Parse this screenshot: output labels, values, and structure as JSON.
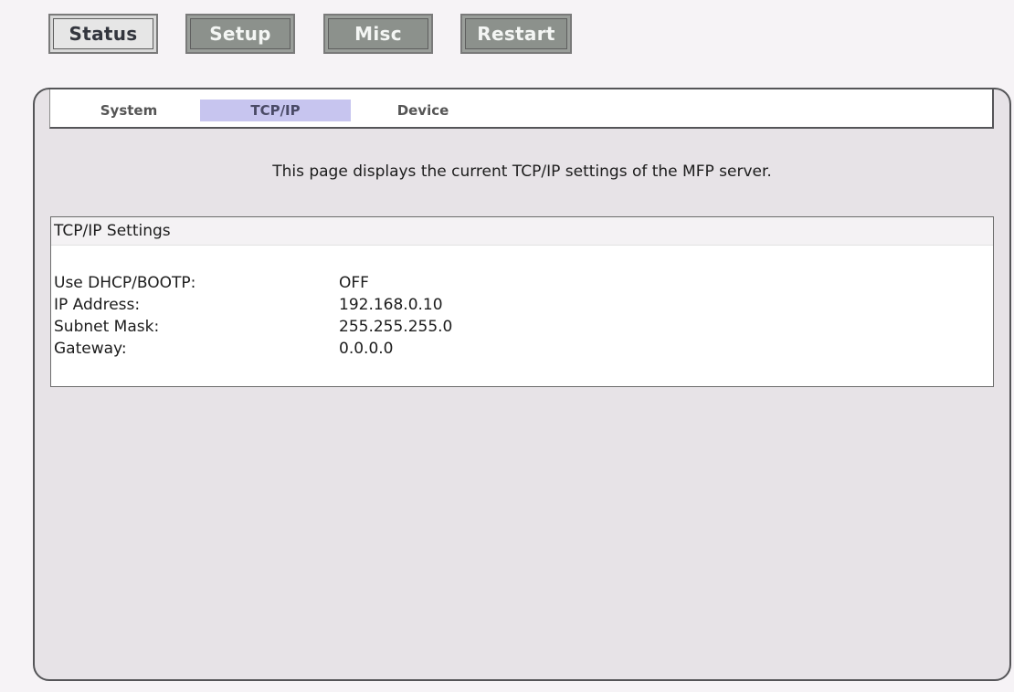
{
  "top_nav": {
    "status": "Status",
    "setup": "Setup",
    "misc": "Misc",
    "restart": "Restart",
    "active": "Status"
  },
  "sub_tabs": {
    "system": "System",
    "tcpip": "TCP/IP",
    "device": "Device",
    "selected": "TCP/IP"
  },
  "description": "This page displays the current TCP/IP settings of the MFP server.",
  "settings": {
    "title": "TCP/IP Settings",
    "rows": [
      {
        "label": "Use DHCP/BOOTP:",
        "value": "OFF"
      },
      {
        "label": "IP Address:",
        "value": "192.168.0.10"
      },
      {
        "label": "Subnet Mask:",
        "value": "255.255.255.0"
      },
      {
        "label": "Gateway:",
        "value": "0.0.0.0"
      }
    ]
  },
  "colors": {
    "page_background": "#f6f3f6",
    "panel_background": "#e7e3e7",
    "selected_subtab": "#c7c5ef",
    "inactive_button": "#8c918c",
    "active_button": "#e6e6e6"
  }
}
